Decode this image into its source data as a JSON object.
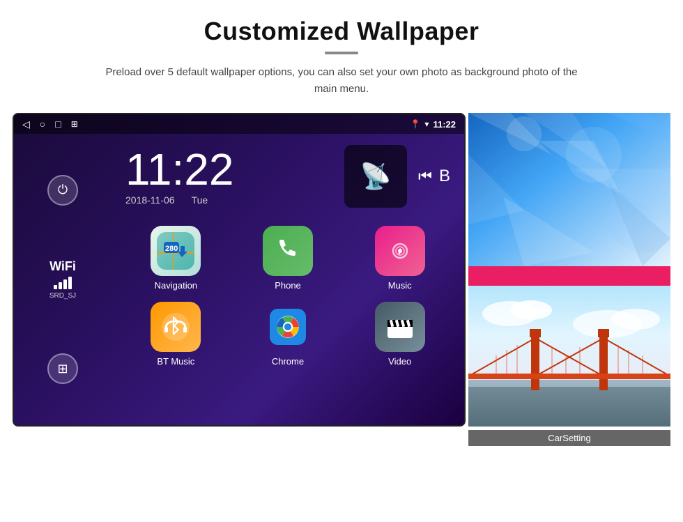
{
  "page": {
    "title": "Customized Wallpaper",
    "description": "Preload over 5 default wallpaper options, you can also set your own photo as background photo of the main menu."
  },
  "statusBar": {
    "time": "11:22",
    "navBack": "◁",
    "navHome": "○",
    "navRecent": "□",
    "navScreenshot": "⊞"
  },
  "clock": {
    "time": "11:22",
    "date": "2018-11-06",
    "day": "Tue"
  },
  "wifi": {
    "label": "WiFi",
    "ssid": "SRD_SJ"
  },
  "apps": [
    {
      "label": "Navigation",
      "type": "navigation"
    },
    {
      "label": "Phone",
      "type": "phone"
    },
    {
      "label": "Music",
      "type": "music"
    },
    {
      "label": "BT Music",
      "type": "bt"
    },
    {
      "label": "Chrome",
      "type": "chrome"
    },
    {
      "label": "Video",
      "type": "video"
    }
  ],
  "wallpapers": {
    "topAlt": "Ice blue wallpaper",
    "bottomAlt": "Golden Gate Bridge wallpaper",
    "carSettingLabel": "CarSetting"
  },
  "colors": {
    "accent": "#e91e63",
    "bg": "#ffffff"
  }
}
